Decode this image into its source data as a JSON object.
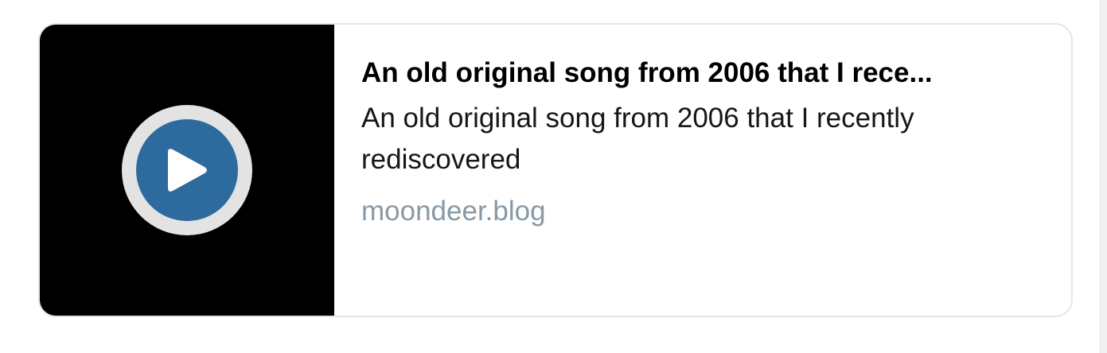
{
  "card": {
    "title": "An old original song from 2006 that I rece...",
    "description": "An old original song from 2006 that I recently rediscovered",
    "domain": "moondeer.blog"
  },
  "media": {
    "icon": "play-icon",
    "background_color": "#000000",
    "ring_color": "#e3e3e3",
    "button_color": "#2d6b9f"
  },
  "colors": {
    "title": "#000000",
    "description": "#14171a",
    "domain": "#8899a6",
    "border": "#e1e8ed"
  }
}
